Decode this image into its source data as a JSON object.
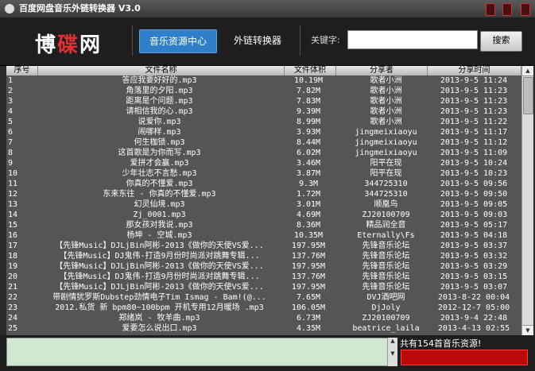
{
  "window": {
    "title": "百度网盘音乐外链转换器 V3.0"
  },
  "header": {
    "logo": {
      "part1": "博",
      "part2": "碟",
      "part3": "网"
    },
    "tabs": [
      {
        "label": "音乐资源中心"
      },
      {
        "label": "外链转换器"
      }
    ],
    "keyword_label": "关键字:",
    "search_value": "",
    "search_button": "搜索"
  },
  "table": {
    "headers": [
      "序号",
      "文件名称",
      "文件体积",
      "分享者",
      "分享时间"
    ],
    "rows": [
      {
        "no": "1",
        "name": "答应我要好好的.mp3",
        "size": "10.19M",
        "sharer": "歌者小洲",
        "time": "2013-9-5 11:24"
      },
      {
        "no": "2",
        "name": "角落里的夕阳.mp3",
        "size": "7.82M",
        "sharer": "歌者小洲",
        "time": "2013-9-5 11:23"
      },
      {
        "no": "3",
        "name": "距离是个问题.mp3",
        "size": "7.83M",
        "sharer": "歌者小洲",
        "time": "2013-9-5 11:23"
      },
      {
        "no": "4",
        "name": "请相信我的心.mp3",
        "size": "9.39M",
        "sharer": "歌者小洲",
        "time": "2013-9-5 11:23"
      },
      {
        "no": "5",
        "name": "说爱你.mp3",
        "size": "8.99M",
        "sharer": "歌者小洲",
        "time": "2013-9-5 11:22"
      },
      {
        "no": "6",
        "name": "闹哪样.mp3",
        "size": "3.93M",
        "sharer": "jingmeixiaoyu",
        "time": "2013-9-5 11:17"
      },
      {
        "no": "7",
        "name": "何生枷锁.mp3",
        "size": "8.44M",
        "sharer": "jingmeixiaoyu",
        "time": "2013-9-5 11:12"
      },
      {
        "no": "8",
        "name": "这首歌是为你而写.mp3",
        "size": "6.02M",
        "sharer": "jingmeixiaoyu",
        "time": "2013-9-5 11:09"
      },
      {
        "no": "9",
        "name": "爱拼才会赢.mp3",
        "size": "3.46M",
        "sharer": "阳平在现",
        "time": "2013-9-5 10:24"
      },
      {
        "no": "10",
        "name": "少年壮志不言愁.mp3",
        "size": "3.87M",
        "sharer": "阳平在现",
        "time": "2013-9-5 10:23"
      },
      {
        "no": "11",
        "name": "你真的不懂爱.mp3",
        "size": "9.3M",
        "sharer": "344725310",
        "time": "2013-9-5 09:56"
      },
      {
        "no": "12",
        "name": "东来东往 - 你真的不懂爱.mp3",
        "size": "1.72M",
        "sharer": "344725310",
        "time": "2013-9-5 09:50"
      },
      {
        "no": "13",
        "name": "幻灵仙境.mp3",
        "size": "3.01M",
        "sharer": "顺凰鸟",
        "time": "2013-9-5 09:05"
      },
      {
        "no": "14",
        "name": "Zj_0001.mp3",
        "size": "4.69M",
        "sharer": "ZJ20100709",
        "time": "2013-9-5 09:03"
      },
      {
        "no": "15",
        "name": "那女孩对我说.mp3",
        "size": "8.36M",
        "sharer": "精品润全音",
        "time": "2013-9-5 05:17"
      },
      {
        "no": "16",
        "name": "杨坤 - 空城.mp3",
        "size": "10.35M",
        "sharer": "Eternally\\Fs",
        "time": "2013-9-5 04:18"
      },
      {
        "no": "17",
        "name": "【先锋Music】DJLjBin阿彬-2013《做你的天使VS爱...",
        "size": "197.95M",
        "sharer": "先锋音乐论坛",
        "time": "2013-9-5 03:37"
      },
      {
        "no": "18",
        "name": "【先锋Music】DJ鬼伟-打造9月份时尚派对跳舞专辑...",
        "size": "137.76M",
        "sharer": "先锋音乐论坛",
        "time": "2013-9-5 03:32"
      },
      {
        "no": "19",
        "name": "【先锋Music】DJLjBin阿彬-2013《做你的天使VS爱...",
        "size": "197.95M",
        "sharer": "先锋音乐论坛",
        "time": "2013-9-5 03:29"
      },
      {
        "no": "20",
        "name": "【先锋Music】DJ鬼伟-打造9月份时尚派对跳舞专辑...",
        "size": "137.76M",
        "sharer": "先锋音乐论坛",
        "time": "2013-9-5 03:15"
      },
      {
        "no": "21",
        "name": "【先锋Music】DJLjBin阿彬-2013《做你的天使VS爱...",
        "size": "197.95M",
        "sharer": "先锋音乐论坛",
        "time": "2013-9-5 03:07"
      },
      {
        "no": "22",
        "name": "带剧情犹罗斯Dubstep劲情电子Tim Ismag - Bam!(@...",
        "size": "7.65M",
        "sharer": "DVJ酒吧网",
        "time": "2013-8-22 00:04"
      },
      {
        "no": "23",
        "name": "2012.私货 新 bpm80~100bpm 开机专用12月暖场 .mp3",
        "size": "106.05M",
        "sharer": "DjJoly",
        "time": "2012-12-7 05:00"
      },
      {
        "no": "24",
        "name": "郑绪岚 - 牧羊曲.mp3",
        "size": "6.73M",
        "sharer": "ZJ20100709",
        "time": "2013-9-4 22:48"
      },
      {
        "no": "25",
        "name": "爱要怎么说出口.mp3",
        "size": "4.35M",
        "sharer": "beatrice_laila",
        "time": "2013-4-13 02:55"
      }
    ]
  },
  "footer": {
    "status": "共有154首音乐资源!"
  },
  "colors": {
    "accent": "#2f7fc8",
    "status_bar": "#bb0a0a"
  },
  "icons": {
    "app": "app-icon",
    "scroll_up": "scroll-up-icon",
    "scroll_down": "scroll-down-icon"
  }
}
